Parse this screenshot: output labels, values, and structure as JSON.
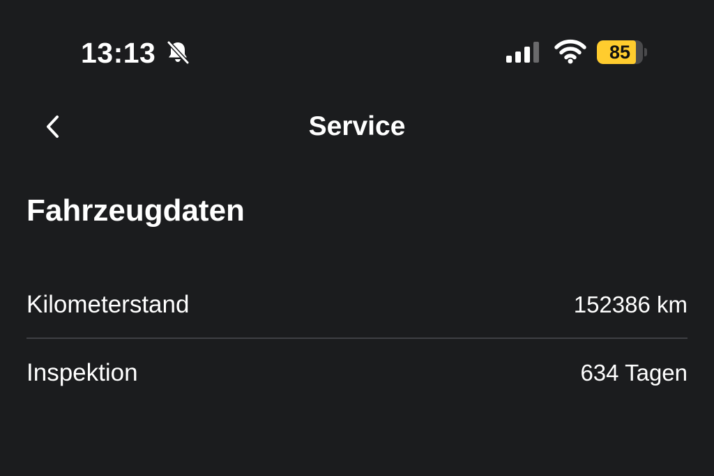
{
  "status_bar": {
    "time": "13:13",
    "silent_icon": "bell-slash-icon",
    "signal_icon": "cellular-signal-icon",
    "wifi_icon": "wifi-icon",
    "battery_level": "85",
    "battery_fraction": 0.85,
    "battery_color": "#ffcc2e"
  },
  "nav": {
    "back_icon": "chevron-left-icon",
    "title": "Service"
  },
  "section": {
    "title": "Fahrzeugdaten"
  },
  "rows": [
    {
      "label": "Kilometerstand",
      "value": "152386 km"
    },
    {
      "label": "Inspektion",
      "value": "634 Tagen"
    }
  ],
  "colors": {
    "background": "#1b1c1e",
    "text": "#ffffff",
    "divider": "#3f4044"
  }
}
